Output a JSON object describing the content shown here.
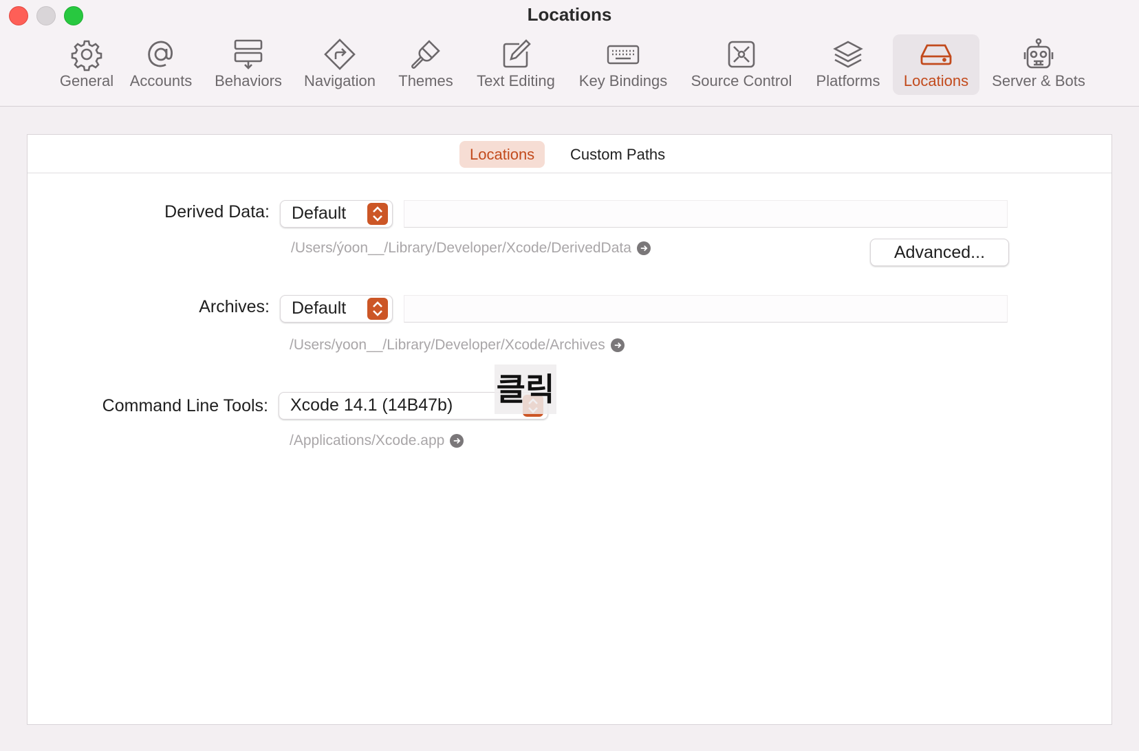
{
  "window": {
    "title": "Locations"
  },
  "toolbar": {
    "tabs": [
      {
        "label": "General",
        "icon": "gear-icon"
      },
      {
        "label": "Accounts",
        "icon": "at-sign-icon"
      },
      {
        "label": "Behaviors",
        "icon": "behaviors-icon"
      },
      {
        "label": "Navigation",
        "icon": "navigation-arrow-icon"
      },
      {
        "label": "Themes",
        "icon": "paintbrush-icon"
      },
      {
        "label": "Text Editing",
        "icon": "pencil-square-icon"
      },
      {
        "label": "Key Bindings",
        "icon": "keyboard-icon"
      },
      {
        "label": "Source Control",
        "icon": "source-control-icon"
      },
      {
        "label": "Platforms",
        "icon": "layers-icon"
      },
      {
        "label": "Locations",
        "icon": "drive-icon"
      },
      {
        "label": "Server & Bots",
        "icon": "robot-icon"
      }
    ],
    "active_tab": "Locations",
    "accent_color": "#c24a1c"
  },
  "segments": {
    "items": [
      "Locations",
      "Custom Paths"
    ],
    "active": "Locations"
  },
  "form": {
    "derived_data": {
      "label": "Derived Data:",
      "selected": "Default",
      "path": "/Users/ýoon__/Library/Developer/Xcode/DerivedData",
      "advanced_button": "Advanced..."
    },
    "archives": {
      "label": "Archives:",
      "selected": "Default",
      "path": "/Users/yoon__/Library/Developer/Xcode/Archives"
    },
    "command_line_tools": {
      "label": "Command Line Tools:",
      "selected": "Xcode 14.1 (14B47b)",
      "path": "/Applications/Xcode.app"
    }
  },
  "annotation": {
    "text": "클릭"
  }
}
